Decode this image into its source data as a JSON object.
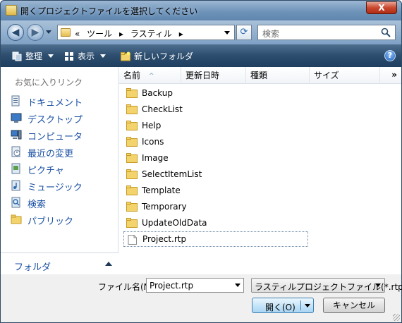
{
  "window": {
    "title": "開くプロジェクトファイルを選択してください",
    "close_label": "X"
  },
  "address": {
    "segments": [
      "«",
      "ツール",
      "▸",
      "ラスティル",
      "▸"
    ],
    "search_placeholder": "検索"
  },
  "toolbar": {
    "organize": "整理",
    "views": "表示",
    "new_folder": "新しいフォルダ",
    "help": "?"
  },
  "favorites": {
    "header": "お気に入りリンク",
    "items": [
      {
        "label": "ドキュメント",
        "icon": "documents-icon"
      },
      {
        "label": "デスクトップ",
        "icon": "desktop-icon"
      },
      {
        "label": "コンピュータ",
        "icon": "computer-icon"
      },
      {
        "label": "最近の変更",
        "icon": "recent-icon"
      },
      {
        "label": "ピクチャ",
        "icon": "pictures-icon"
      },
      {
        "label": "ミュージック",
        "icon": "music-icon"
      },
      {
        "label": "検索",
        "icon": "search-folder-icon"
      },
      {
        "label": "パブリック",
        "icon": "public-folder-icon"
      }
    ],
    "folders_label": "フォルダ"
  },
  "columns": {
    "name": "名前",
    "modified": "更新日時",
    "type": "種類",
    "size": "サイズ",
    "more": "»"
  },
  "files": [
    {
      "name": "Backup",
      "kind": "folder"
    },
    {
      "name": "CheckList",
      "kind": "folder"
    },
    {
      "name": "Help",
      "kind": "folder"
    },
    {
      "name": "Icons",
      "kind": "folder"
    },
    {
      "name": "Image",
      "kind": "folder"
    },
    {
      "name": "SelectItemList",
      "kind": "folder"
    },
    {
      "name": "Template",
      "kind": "folder"
    },
    {
      "name": "Temporary",
      "kind": "folder"
    },
    {
      "name": "UpdateOldData",
      "kind": "folder"
    },
    {
      "name": "Project.rtp",
      "kind": "file",
      "selected": true
    }
  ],
  "footer": {
    "filename_label": "ファイル名(N):",
    "filename_value": "Project.rtp",
    "filetype_value": "ラスティルプロジェクトファイル(*.rtp)",
    "open_label": "開く(O)",
    "cancel_label": "キャンセル"
  },
  "colors": {
    "link": "#1a4fa3",
    "toolbar": "#2c4d6e",
    "title_bar": "#6e93b9"
  }
}
